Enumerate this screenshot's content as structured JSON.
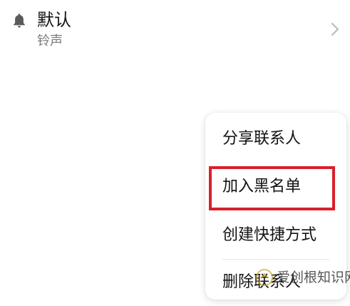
{
  "ringtone": {
    "icon": "bell-icon",
    "value": "默认",
    "label": "铃声",
    "chevron_icon": "chevron-right-icon"
  },
  "menu": {
    "items": [
      {
        "label": "分享联系人"
      },
      {
        "label": "加入黑名单"
      },
      {
        "label": "创建快捷方式"
      },
      {
        "label": "删除联系人"
      }
    ],
    "highlight_color": "#d9202a"
  },
  "watermark": {
    "text": "爱创根知识网"
  }
}
